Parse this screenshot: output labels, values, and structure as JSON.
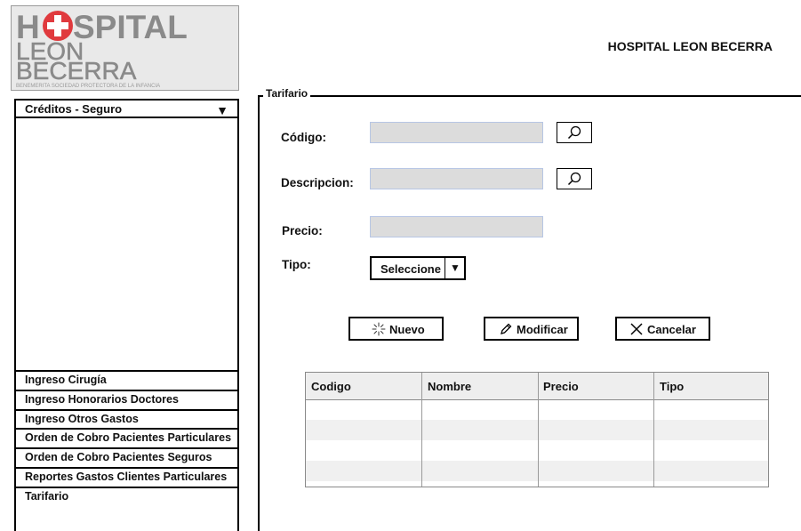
{
  "logo": {
    "line1": "H",
    "line1b": "SPITAL",
    "line2": "LEON",
    "line3": "BECERRA",
    "tagline": "BENEMERITA SOCIEDAD PROTECTORA DE LA INFANCIA",
    "cross_color": "#e03a3e"
  },
  "header": {
    "title": "HOSPITAL LEON BECERRA"
  },
  "sidebar": {
    "dropdown_label": "Créditos - Seguro",
    "items": [
      {
        "label": "Ingreso Cirugía"
      },
      {
        "label": "Ingreso Honorarios Doctores"
      },
      {
        "label": "Ingreso Otros Gastos"
      },
      {
        "label": "Orden de Cobro Pacientes Particulares"
      },
      {
        "label": "Orden de Cobro Pacientes Seguros"
      },
      {
        "label": "Reportes Gastos Clientes Particulares"
      },
      {
        "label": "Tarifario"
      }
    ]
  },
  "form": {
    "section_title": "Tarifario",
    "codigo_label": "Código:",
    "codigo_value": "",
    "descripcion_label": "Descripcion:",
    "descripcion_value": "",
    "precio_label": "Precio:",
    "precio_value": "",
    "tipo_label": "Tipo:",
    "tipo_selected": "Seleccione"
  },
  "buttons": {
    "nuevo": "Nuevo",
    "modificar": "Modificar",
    "cancelar": "Cancelar"
  },
  "table": {
    "columns": [
      "Codigo",
      "Nombre",
      "Precio",
      "Tipo"
    ],
    "rows": [
      [
        "",
        "",
        "",
        ""
      ],
      [
        "",
        "",
        "",
        ""
      ],
      [
        "",
        "",
        "",
        ""
      ],
      [
        "",
        "",
        "",
        ""
      ]
    ]
  }
}
